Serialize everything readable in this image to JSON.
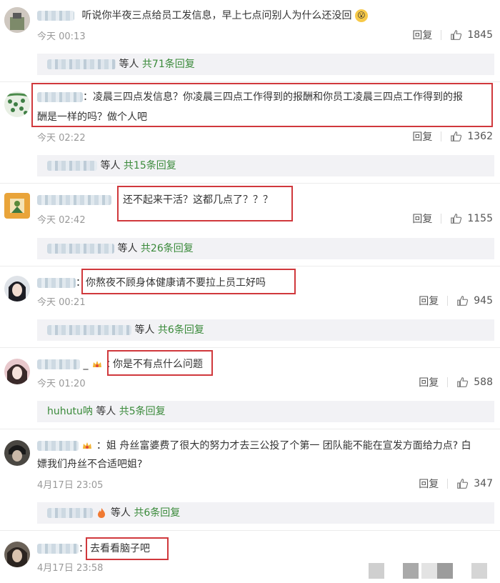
{
  "comments": [
    {
      "text": "听说你半夜三点给员工发信息，早上七点问别人为什么还没回",
      "time": "今天 00:13",
      "reply_label": "回复",
      "likes": "1845",
      "reply_summary": {
        "suffix": "等人",
        "count": "共71条回复"
      }
    },
    {
      "text_line1": "凌晨三四点发信息？你凌晨三四点工作得到的报酬和你员工凌晨三四点工作得到的报",
      "text_line2": "酬是一样的吗？做个人吧",
      "time": "今天 02:22",
      "reply_label": "回复",
      "likes": "1362",
      "reply_summary": {
        "suffix": "等人",
        "count": "共15条回复"
      }
    },
    {
      "text": "还不起来干活？这都几点了？？？",
      "time": "今天 02:42",
      "reply_label": "回复",
      "likes": "1155",
      "reply_summary": {
        "suffix": "等人",
        "count": "共26条回复"
      }
    },
    {
      "text": "你熬夜不顾身体健康请不要拉上员工好吗",
      "time": "今天 00:21",
      "reply_label": "回复",
      "likes": "945",
      "reply_summary": {
        "suffix": "等人",
        "count": "共6条回复"
      }
    },
    {
      "text": "你是不有点什么问题",
      "time": "今天 01:20",
      "reply_label": "回复",
      "likes": "588",
      "reply_summary": {
        "user": "huhutu呐",
        "suffix": "等人",
        "count": "共5条回复"
      }
    },
    {
      "text_line1": "姐 舟丝富婆费了很大的努力才去三公投了个第一 团队能不能在宣发方面给力点? 白",
      "text_line2": "嫖我们舟丝不合适吧姐?",
      "time": "4月17日 23:05",
      "reply_label": "回复",
      "likes": "347",
      "reply_summary": {
        "suffix": "等人",
        "count": "共6条回复"
      }
    },
    {
      "text": "去看看脑子吧",
      "time": "4月17日 23:58"
    }
  ],
  "colors": {
    "highlight": "#d0383c",
    "reply_count": "#3a8a3a"
  }
}
